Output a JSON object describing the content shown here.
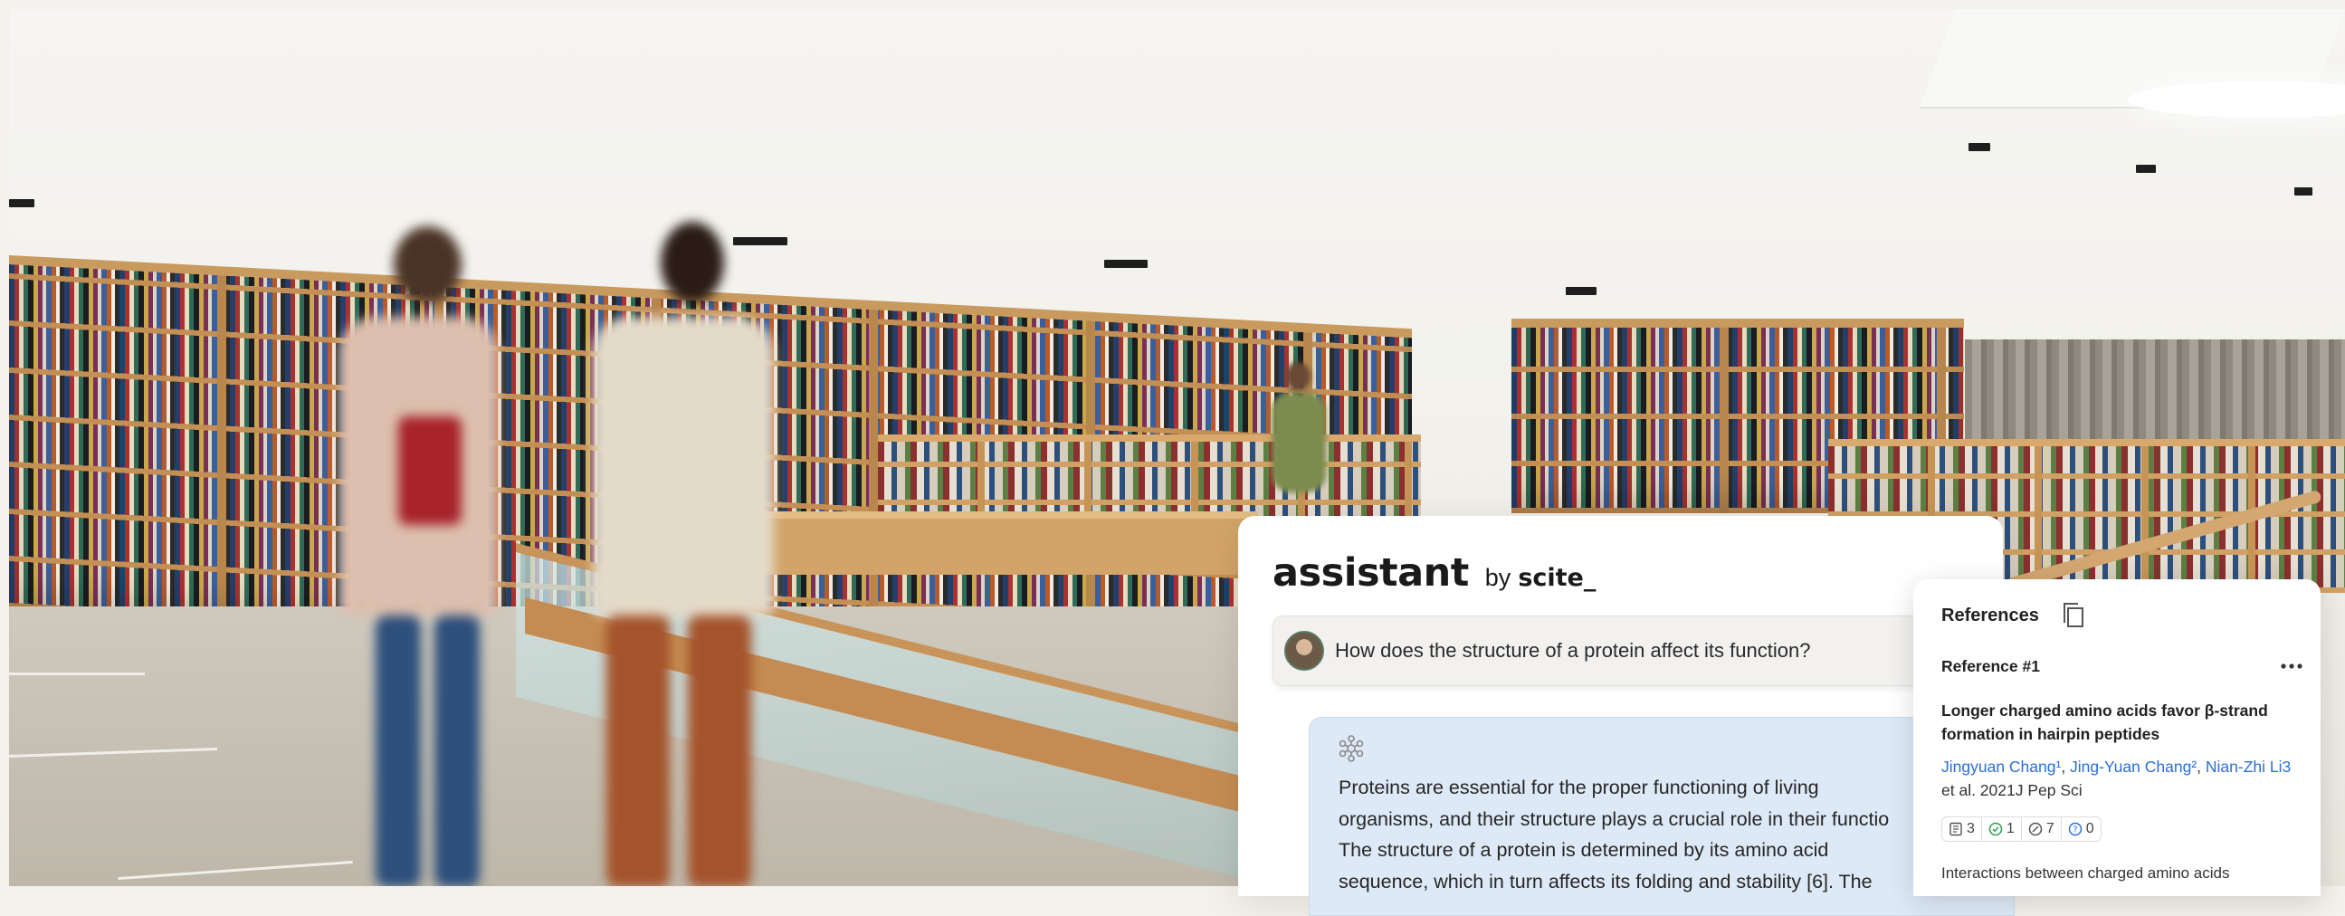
{
  "assistant": {
    "title": "assistant",
    "by_label": "by",
    "brand": "scite_",
    "question": "How does the structure of a protein affect its function?",
    "answer_lines": [
      "Proteins are essential for the proper functioning of living",
      "organisms, and their structure plays a crucial role in their functio",
      "The structure of a protein is determined by its amino acid",
      "sequence, which in turn affects its folding and stability [6]. The"
    ],
    "icons": {
      "avatar": "user-avatar",
      "bot": "scite-bot-icon"
    }
  },
  "references": {
    "title": "References",
    "copy_icon": "copy-icon",
    "reference_number": "Reference #1",
    "more_icon": "more-horizontal-icon",
    "paper_title": "Longer charged amino acids favor β-strand formation in hairpin peptides",
    "authors": [
      "Jingyuan Chang¹",
      "Jing-Yuan Chang²",
      "Nian-Zhi Li3"
    ],
    "author_separator": ", ",
    "citation_suffix": " et al. 2021J Pep Sci",
    "stats": [
      {
        "icon": "document-icon",
        "value": "3",
        "color": "#555555"
      },
      {
        "icon": "check-circle-icon",
        "value": "1",
        "color": "#2e9d4a"
      },
      {
        "icon": "slash-circle-icon",
        "value": "7",
        "color": "#555555"
      },
      {
        "icon": "question-circle-icon",
        "value": "0",
        "color": "#2a6fd6"
      }
    ],
    "excerpt": "Interactions between charged amino acids"
  },
  "colors": {
    "answer_background": "#dde9f6",
    "link": "#2a6fd6",
    "supporting": "#2e9d4a"
  }
}
